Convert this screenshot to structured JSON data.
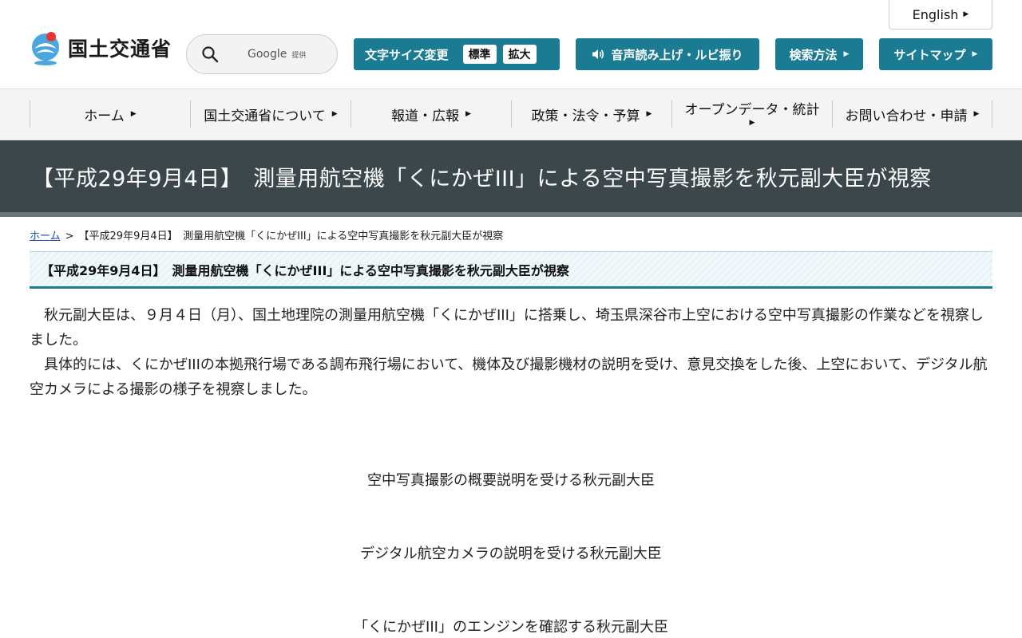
{
  "header": {
    "logo_text": "国土交通省",
    "search": {
      "label": "Google",
      "sub": "提供"
    },
    "english_label": "English",
    "font_size": {
      "label": "文字サイズ変更",
      "standard": "標準",
      "large": "拡大"
    },
    "voice_label": "音声読み上げ・ルビ振り",
    "search_method_label": "検索方法",
    "sitemap_label": "サイトマップ"
  },
  "gnav": {
    "items": [
      {
        "label": "ホーム"
      },
      {
        "label": "国土交通省について"
      },
      {
        "label": "報道・広報"
      },
      {
        "label": "政策・法令・予算"
      },
      {
        "label": "オープンデータ・統計"
      },
      {
        "label": "お問い合わせ・申請"
      }
    ]
  },
  "page": {
    "title": "【平成29年9月4日】　測量用航空機「くにかぜIII」による空中写真撮影を秋元副大臣が視察",
    "breadcrumb": {
      "home": "ホーム",
      "separator": ">",
      "current": "【平成29年9月4日】　測量用航空機「くにかぜIII」による空中写真撮影を秋元副大臣が視察"
    },
    "heading": "【平成29年9月4日】　測量用航空機「くにかぜIII」による空中写真撮影を秋元副大臣が視察",
    "paragraphs": [
      "秋元副大臣は、９月４日（月）、国土地理院の測量用航空機「くにかぜIII」に搭乗し、埼玉県深谷市上空における空中写真撮影の作業などを視察しました。",
      "具体的には、くにかぜIIIの本拠飛行場である調布飛行場において、機体及び撮影機材の説明を受け、意見交換をした後、上空において、デジタル航空カメラによる撮影の様子を視察しました。"
    ],
    "captions": [
      "空中写真撮影の概要説明を受ける秋元副大臣",
      "デジタル航空カメラの説明を受ける秋元副大臣",
      "「くにかぜIII」のエンジンを確認する秋元副大臣"
    ]
  },
  "colors": {
    "accent": "#1b7b93",
    "title_band": "#3c474b",
    "nav_bg": "#f4f4f4"
  }
}
